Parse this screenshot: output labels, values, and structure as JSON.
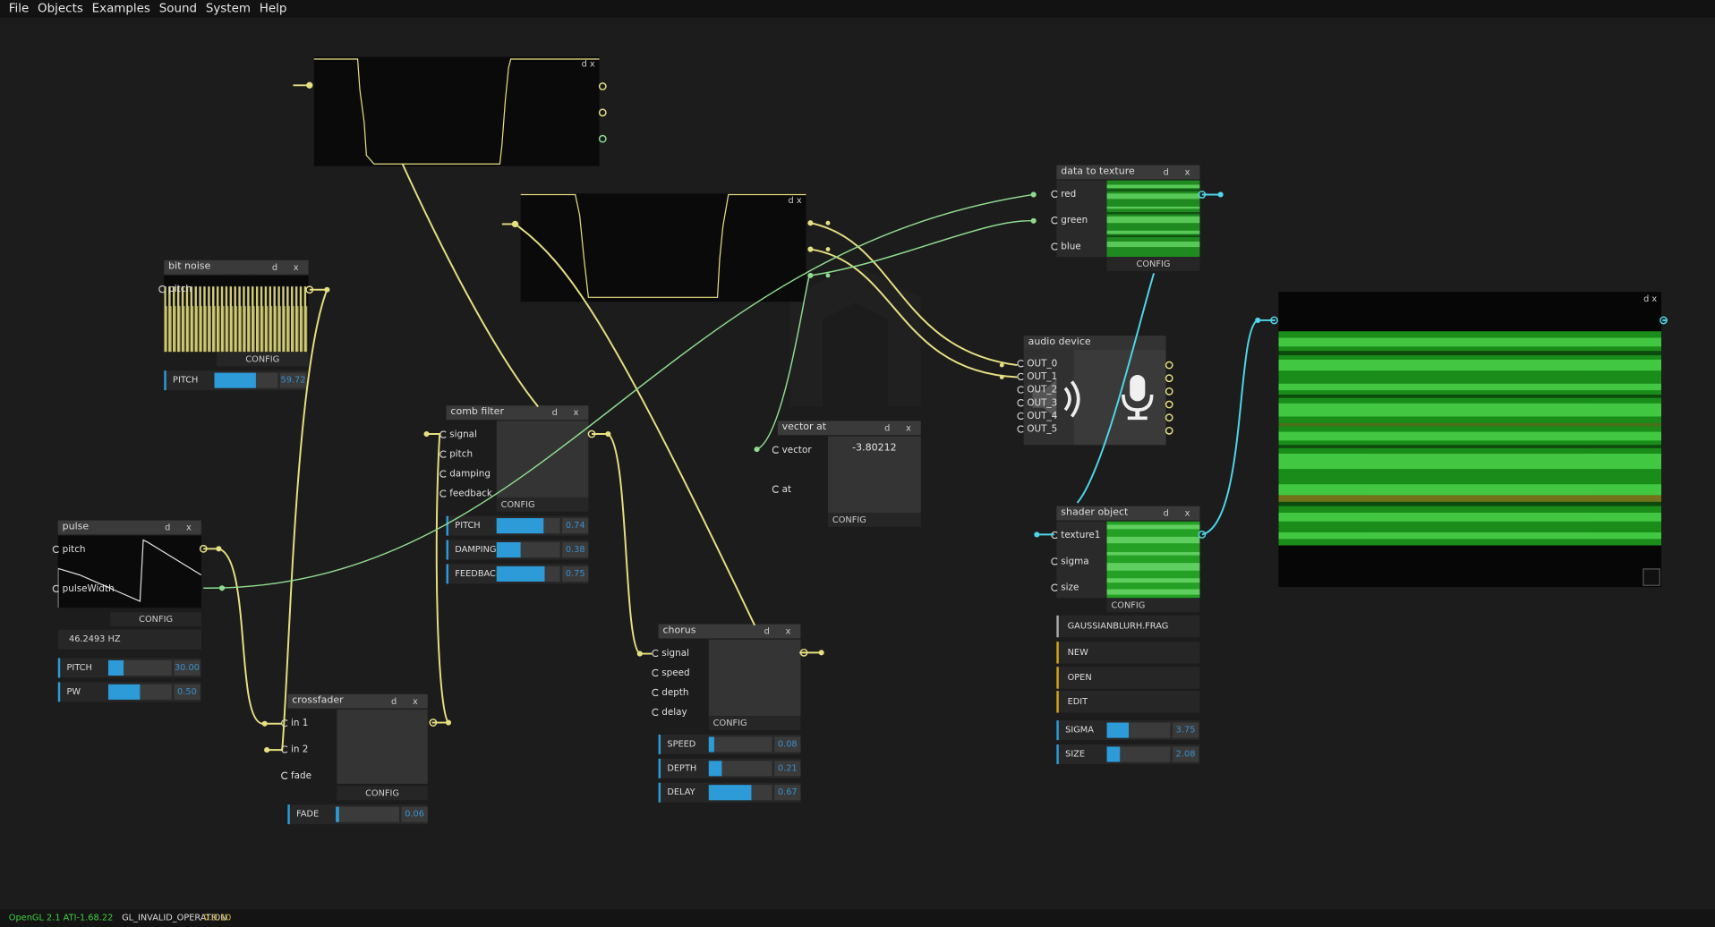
{
  "menu": [
    "File",
    "Objects",
    "Examples",
    "Sound",
    "System",
    "Help"
  ],
  "node_controls": "d x",
  "config_label": "CONFIG",
  "nodes": {
    "bit_noise": {
      "title": "bit noise",
      "ports": [
        "pitch"
      ],
      "sliders": [
        {
          "label": "PITCH",
          "value": "59.72",
          "fraction": 0.6
        }
      ]
    },
    "pulse": {
      "title": "pulse",
      "ports": [
        "pitch",
        "pulseWidth"
      ],
      "readout": "46.2493 HZ",
      "sliders": [
        {
          "label": "PITCH",
          "value": "30.00",
          "fraction": 0.25
        },
        {
          "label": "PW",
          "value": "0.50",
          "fraction": 0.5
        }
      ]
    },
    "comb_filter": {
      "title": "comb filter",
      "ports": [
        "signal",
        "pitch",
        "damping",
        "feedback"
      ],
      "sliders": [
        {
          "label": "PITCH",
          "value": "0.74",
          "fraction": 0.74
        },
        {
          "label": "DAMPING",
          "value": "0.38",
          "fraction": 0.38
        },
        {
          "label": "FEEDBACK",
          "value": "0.75",
          "fraction": 0.75
        }
      ]
    },
    "crossfader": {
      "title": "crossfader",
      "ports": [
        "in 1",
        "in 2",
        "fade"
      ],
      "sliders": [
        {
          "label": "FADE",
          "value": "0.06",
          "fraction": 0.06
        }
      ]
    },
    "chorus": {
      "title": "chorus",
      "ports": [
        "signal",
        "speed",
        "depth",
        "delay"
      ],
      "sliders": [
        {
          "label": "SPEED",
          "value": "0.08",
          "fraction": 0.08
        },
        {
          "label": "DEPTH",
          "value": "0.21",
          "fraction": 0.21
        },
        {
          "label": "DELAY",
          "value": "0.67",
          "fraction": 0.67
        }
      ]
    },
    "vector_at": {
      "title": "vector at",
      "ports": [
        "vector",
        "at"
      ],
      "value": "-3.80212"
    },
    "data_to_texture": {
      "title": "data to texture",
      "ports": [
        "red",
        "green",
        "blue"
      ]
    },
    "audio_device": {
      "title": "audio device",
      "ports": [
        "OUT_0",
        "OUT_1",
        "OUT_2",
        "OUT_3",
        "OUT_4",
        "OUT_5"
      ]
    },
    "shader_object": {
      "title": "shader object",
      "ports": [
        "texture1",
        "sigma",
        "size"
      ],
      "buttons": [
        "GAUSSIANBLURH.FRAG",
        "NEW",
        "OPEN",
        "EDIT"
      ],
      "sliders": [
        {
          "label": "SIGMA",
          "value": "3.75",
          "fraction": 0.35
        },
        {
          "label": "SIZE",
          "value": "2.08",
          "fraction": 0.2
        }
      ]
    }
  },
  "status": {
    "gl": "OpenGL 2.1 ATI-1.68.22",
    "error": "GL_INVALID_OPERATION",
    "overlay": "0.9.10"
  },
  "colors": {
    "wire_audio": "#e6e082",
    "wire_data": "#8fdc8f",
    "wire_texture": "#4fd6ea",
    "slider_fill": "#2c9bd8",
    "button_edge": "#d4a51c"
  }
}
